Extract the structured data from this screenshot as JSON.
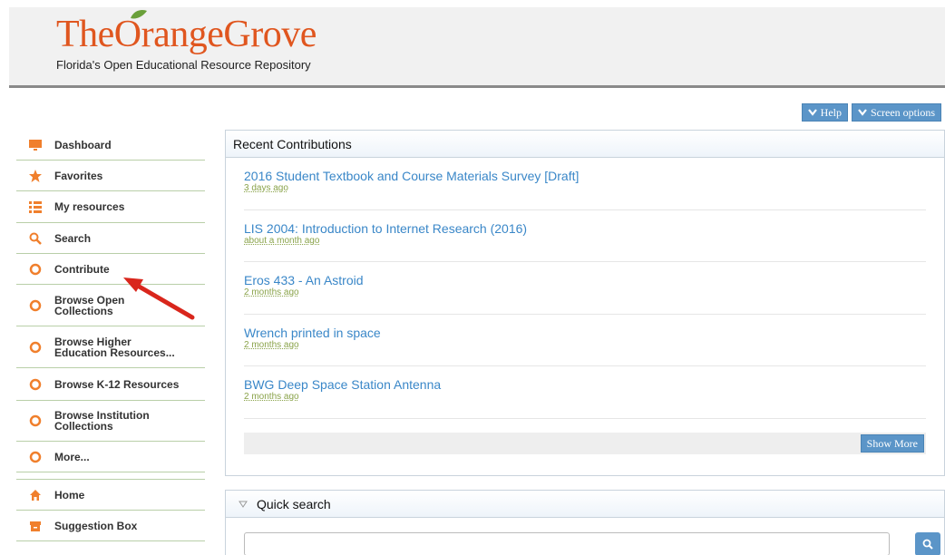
{
  "header": {
    "logo_text": "TheOrangeGrove",
    "tagline": "Florida's Open Educational Resource Repository"
  },
  "top_buttons": {
    "help": "Help",
    "screen_options": "Screen options"
  },
  "sidebar": {
    "items": [
      {
        "label": "Dashboard",
        "icon": "monitor-icon"
      },
      {
        "label": "Favorites",
        "icon": "star-icon"
      },
      {
        "label": "My resources",
        "icon": "list-icon"
      },
      {
        "label": "Search",
        "icon": "search-icon"
      },
      {
        "label": "Contribute",
        "icon": "circle-icon"
      },
      {
        "label": "Browse Open\nCollections",
        "icon": "circle-icon"
      },
      {
        "label": "Browse Higher\nEducation Resources...",
        "icon": "circle-icon"
      },
      {
        "label": "Browse K-12 Resources",
        "icon": "circle-icon"
      },
      {
        "label": "Browse Institution\nCollections",
        "icon": "circle-icon"
      },
      {
        "label": "More...",
        "icon": "circle-icon"
      },
      {
        "label": "Home",
        "icon": "home-icon"
      },
      {
        "label": "Suggestion Box",
        "icon": "box-icon"
      }
    ]
  },
  "recent": {
    "title": "Recent Contributions",
    "items": [
      {
        "title": "2016 Student Textbook and Course Materials Survey [Draft]",
        "ago": "3 days ago"
      },
      {
        "title": "LIS 2004: Introduction to Internet Research (2016)",
        "ago": "about a month ago"
      },
      {
        "title": "Eros 433 - An Astroid",
        "ago": "2 months ago"
      },
      {
        "title": "Wrench printed in space",
        "ago": "2 months ago"
      },
      {
        "title": "BWG Deep Space Station Antenna",
        "ago": "2 months ago"
      }
    ],
    "show_more": "Show More"
  },
  "quick_search": {
    "title": "Quick search",
    "placeholder": ""
  },
  "colors": {
    "accent_orange": "#e0561f",
    "link_blue": "#3a87c8",
    "button_blue": "#5b95c8",
    "meta_green": "#8aa34a"
  }
}
